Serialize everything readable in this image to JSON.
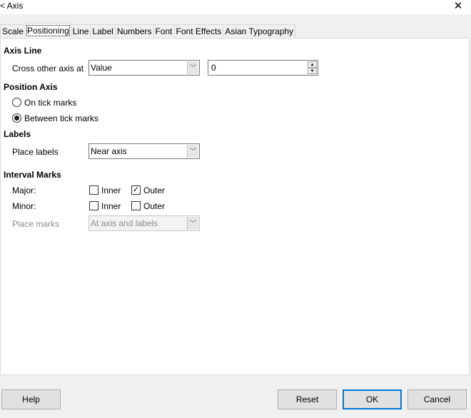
{
  "window": {
    "title": "< Axis",
    "close_icon": "close-icon"
  },
  "tabs": [
    {
      "label": "Scale"
    },
    {
      "label": "Positioning",
      "active": true
    },
    {
      "label": "Line"
    },
    {
      "label": "Label"
    },
    {
      "label": "Numbers"
    },
    {
      "label": "Font"
    },
    {
      "label": "Font Effects"
    },
    {
      "label": "Asian Typography"
    }
  ],
  "axis_line": {
    "heading": "Axis Line",
    "cross_label": "Cross other axis at",
    "cross_value": "Value",
    "cross_number": "0"
  },
  "position_axis": {
    "heading": "Position Axis",
    "on_tick": "On tick marks",
    "between_tick": "Between tick marks",
    "selected": "between"
  },
  "labels": {
    "heading": "Labels",
    "place_label": "Place labels",
    "place_value": "Near axis"
  },
  "interval_marks": {
    "heading": "Interval Marks",
    "major": "Major:",
    "minor": "Minor:",
    "inner": "Inner",
    "outer": "Outer",
    "major_inner": false,
    "major_outer": true,
    "minor_inner": false,
    "minor_outer": false,
    "place_marks_label": "Place marks",
    "place_marks_value": "At axis and labels"
  },
  "buttons": {
    "help": "Help",
    "reset": "Reset",
    "ok": "OK",
    "cancel": "Cancel"
  },
  "colors": {
    "accent": "#0078d7"
  }
}
